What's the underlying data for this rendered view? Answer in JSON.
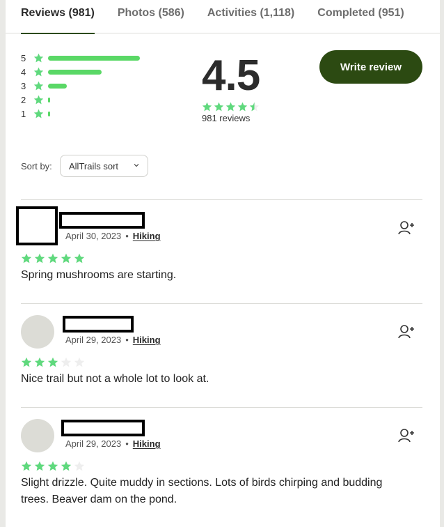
{
  "tabs": [
    {
      "label": "Reviews (981)",
      "active": true
    },
    {
      "label": "Photos (586)",
      "active": false
    },
    {
      "label": "Activities (1,118)",
      "active": false
    },
    {
      "label": "Completed (951)",
      "active": false
    }
  ],
  "rating_distribution": [
    {
      "stars": "5",
      "fraction": 0.94
    },
    {
      "stars": "4",
      "fraction": 0.55
    },
    {
      "stars": "3",
      "fraction": 0.19
    },
    {
      "stars": "2",
      "fraction": 0.02
    },
    {
      "stars": "1",
      "fraction": 0.02
    }
  ],
  "average": {
    "value": "4.5",
    "stars": 4.5,
    "count_label": "981 reviews"
  },
  "write_review_label": "Write review",
  "sort": {
    "label": "Sort by:",
    "value": "AllTrails sort"
  },
  "reviews": [
    {
      "date": "April 30, 2023",
      "activity": "Hiking",
      "rating": 5,
      "text": "Spring mushrooms are starting."
    },
    {
      "date": "April 29, 2023",
      "activity": "Hiking",
      "rating": 3,
      "text": "Nice trail but not a whole lot to look at."
    },
    {
      "date": "April 29, 2023",
      "activity": "Hiking",
      "rating": 4,
      "text": "Slight drizzle. Quite muddy in sections. Lots of birds chirping and budding trees. Beaver dam on the pond."
    }
  ],
  "colors": {
    "accent": "#2c4a12",
    "star_filled": "#5fd97d",
    "star_empty": "#eeeeee",
    "bar": "#5ad866"
  },
  "icons": {
    "follow": "add-person-icon",
    "star": "star-icon",
    "chevron": "chevron-down-icon"
  }
}
